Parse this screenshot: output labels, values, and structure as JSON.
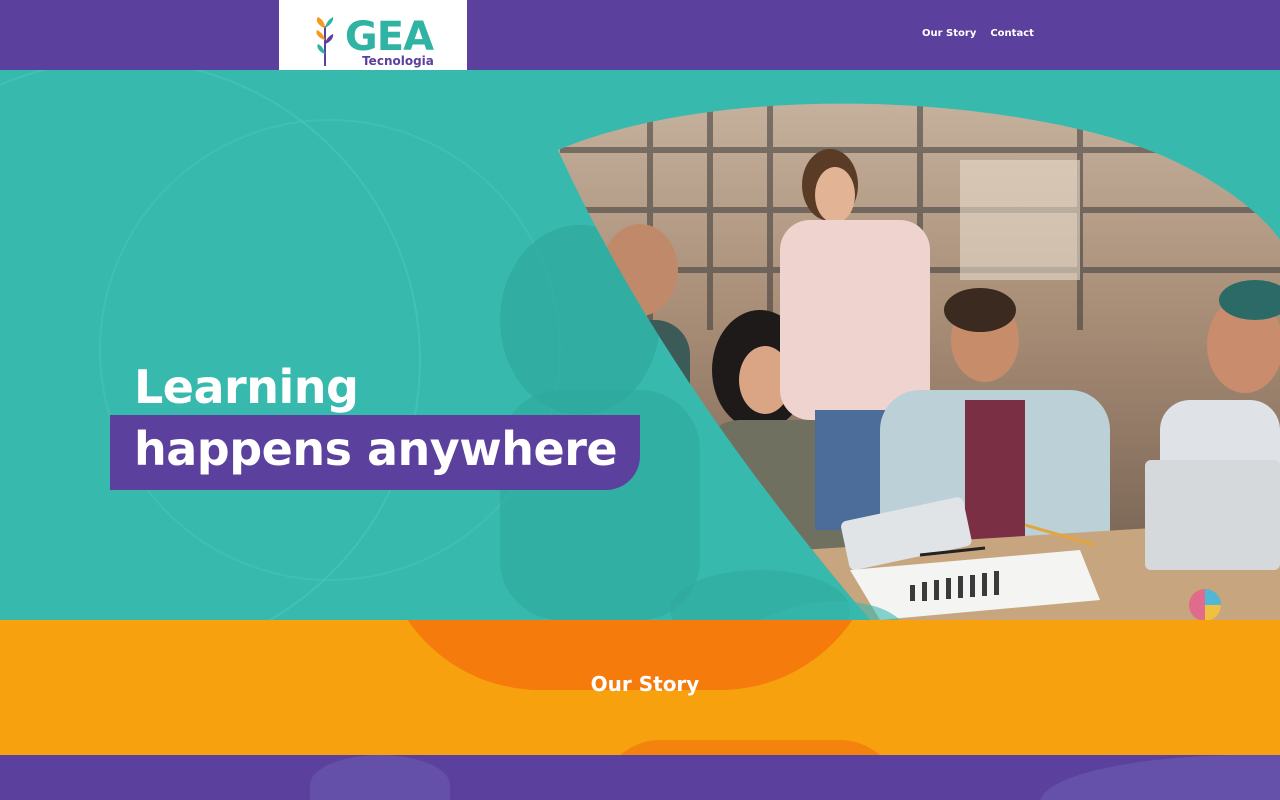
{
  "brand": {
    "name": "GEA",
    "tagline": "Tecnologia",
    "colors": {
      "purple": "#5b409d",
      "teal": "#37b9ad",
      "orange": "#f7a10f"
    }
  },
  "nav": {
    "items": [
      {
        "label": "Our Story"
      },
      {
        "label": "Contact"
      }
    ]
  },
  "hero": {
    "line1": "Learning",
    "line2": "happens anywhere"
  },
  "story": {
    "title": "Our Story"
  }
}
